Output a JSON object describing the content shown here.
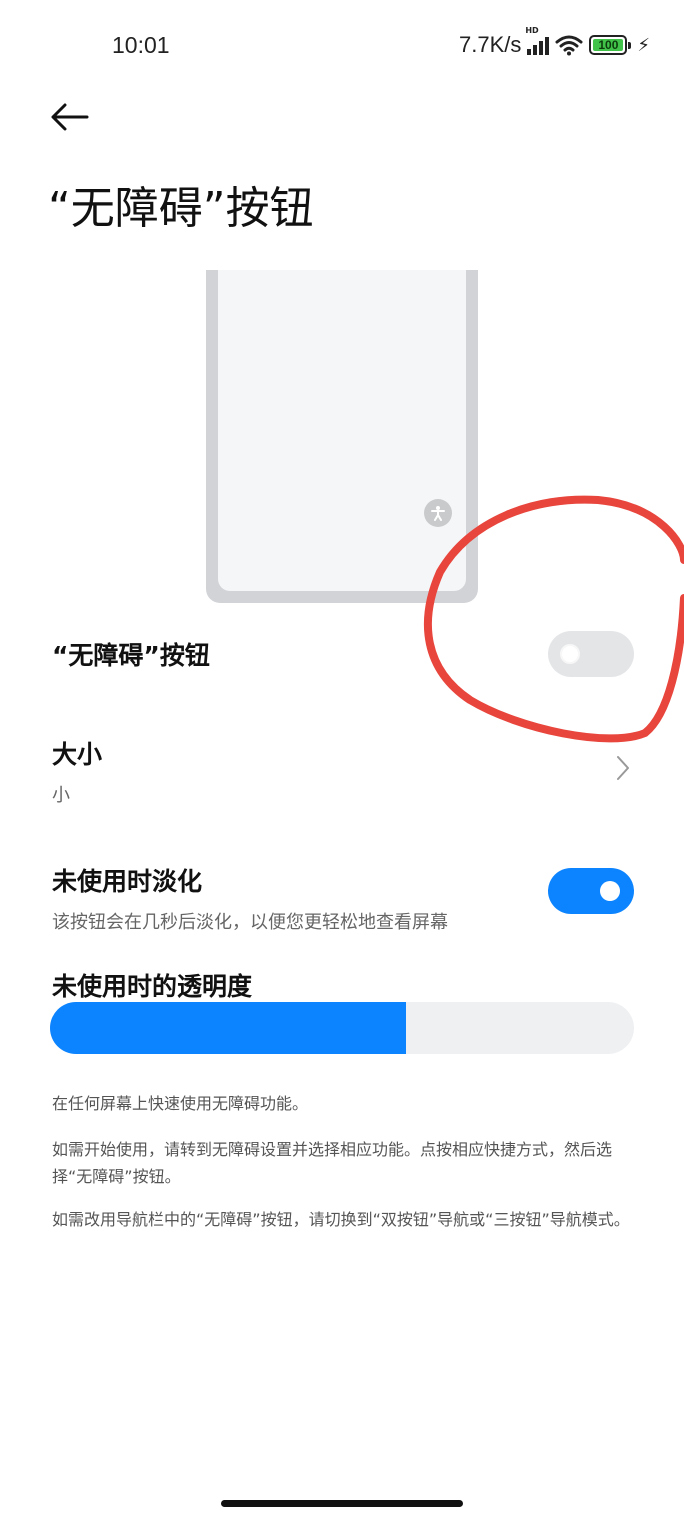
{
  "status_bar": {
    "time": "10:01",
    "net_speed": "7.7K/s",
    "signal_tag": "HD",
    "battery_level": "100",
    "icons": [
      "signal-icon",
      "wifi-icon",
      "battery-icon",
      "charging-icon"
    ]
  },
  "header": {
    "back_icon": "arrow-left-icon",
    "title": "“无障碍”按钮"
  },
  "settings": {
    "a11y_button": {
      "label": "“无障碍”按钮",
      "enabled": false
    },
    "size": {
      "label": "大小",
      "value": "小"
    },
    "fade": {
      "label": "未使用时淡化",
      "description": "该按钮会在几秒后淡化，以便您更轻松地查看屏幕",
      "enabled": true
    },
    "opacity": {
      "label": "未使用时的透明度",
      "value_fraction": 0.61
    }
  },
  "descriptions": [
    "在任何屏幕上快速使用无障碍功能。",
    "如需开始使用，请转到无障碍设置并选择相应功能。点按相应快捷方式，然后选择“无障碍”按钮。",
    "如需改用导航栏中的“无障碍”按钮，请切换到“双按钮”导航或“三按钮”导航模式。"
  ],
  "colors": {
    "accent": "#0d84ff",
    "toggle_off": "#e4e5e7",
    "annotation": "#e8453c"
  }
}
